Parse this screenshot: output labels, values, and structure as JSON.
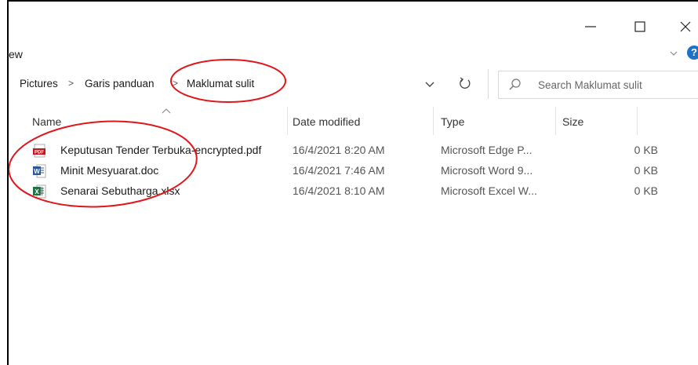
{
  "window": {
    "controls": {
      "minimize": "minimize-icon",
      "maximize": "maximize-icon",
      "close": "close-icon"
    }
  },
  "ribbon": {
    "tab_label": "ew",
    "expand_icon": "chevron-down-icon",
    "help_label": "?"
  },
  "address": {
    "crumbs": [
      "Pictures",
      "Garis panduan",
      "Maklumat sulit"
    ],
    "separator": ">",
    "dropdown_icon": "chevron-down-icon",
    "refresh_icon": "refresh-icon"
  },
  "search": {
    "placeholder": "Search Maklumat sulit",
    "icon": "search-icon"
  },
  "columns": {
    "name": "Name",
    "date_modified": "Date modified",
    "type": "Type",
    "size": "Size"
  },
  "files": [
    {
      "name": "Keputusan Tender Terbuka-encrypted.pdf",
      "date_modified": "16/4/2021 8:20 AM",
      "type": "Microsoft Edge P...",
      "size": "0 KB",
      "icon": "pdf-file-icon"
    },
    {
      "name": "Minit Mesyuarat.doc",
      "date_modified": "16/4/2021 7:46 AM",
      "type": "Microsoft Word 9...",
      "size": "0 KB",
      "icon": "word-file-icon"
    },
    {
      "name": "Senarai Sebutharga.xlsx",
      "date_modified": "16/4/2021 8:10 AM",
      "type": "Microsoft Excel W...",
      "size": "0 KB",
      "icon": "excel-file-icon"
    }
  ],
  "colors": {
    "annotation": "#e0161b",
    "pdf": "#c4161c",
    "word": "#2b579a",
    "excel": "#217346",
    "help": "#1a73c8"
  }
}
